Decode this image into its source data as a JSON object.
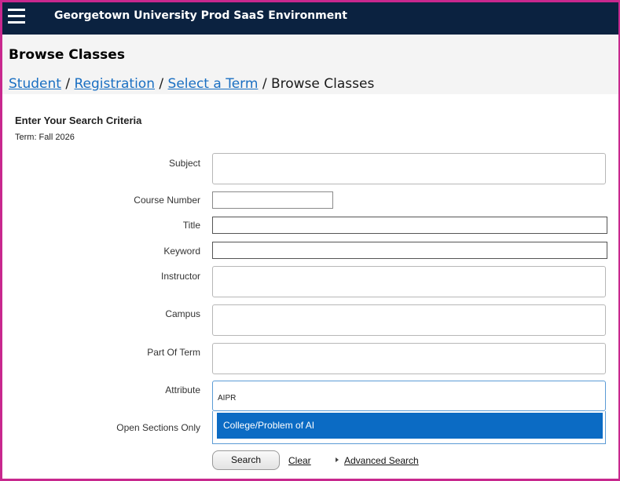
{
  "header": {
    "app_title": "Georgetown University Prod SaaS Environment"
  },
  "page": {
    "title": "Browse Classes"
  },
  "breadcrumb": {
    "items": [
      "Student",
      "Registration",
      "Select a Term"
    ],
    "separator": "/",
    "current": "Browse Classes"
  },
  "form": {
    "heading": "Enter Your Search Criteria",
    "term": "Term: Fall 2026",
    "fields": {
      "subject": {
        "label": "Subject",
        "value": ""
      },
      "course_number": {
        "label": "Course Number",
        "value": ""
      },
      "title": {
        "label": "Title",
        "value": ""
      },
      "keyword": {
        "label": "Keyword",
        "value": ""
      },
      "instructor": {
        "label": "Instructor",
        "value": ""
      },
      "campus": {
        "label": "Campus",
        "value": ""
      },
      "part_of_term": {
        "label": "Part Of Term",
        "value": ""
      },
      "attribute": {
        "label": "Attribute",
        "value": "AIPR"
      },
      "open_sections": {
        "label": "Open Sections Only"
      }
    },
    "attribute_suggestions": [
      "College/Problem of AI"
    ],
    "buttons": {
      "search": "Search",
      "clear": "Clear",
      "advanced": "Advanced Search"
    }
  },
  "colors": {
    "topbar": "#0b2240",
    "link": "#1a6fc2",
    "highlight": "#0b6bc4",
    "frame": "#c8288e"
  },
  "icons": {
    "menu": "hamburger-menu-icon",
    "expand": "triangle-right-icon"
  }
}
